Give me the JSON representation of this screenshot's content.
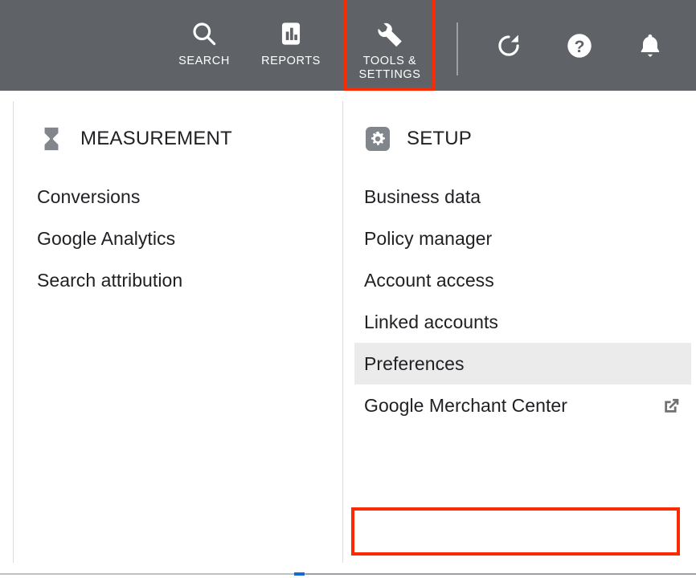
{
  "topbar": {
    "background": "#5f6368",
    "nav": [
      {
        "id": "search",
        "label": "SEARCH",
        "icon": "search-icon"
      },
      {
        "id": "reports",
        "label": "REPORTS",
        "icon": "bar-chart-icon"
      },
      {
        "id": "tools",
        "label": "TOOLS &\nSETTINGS",
        "icon": "wrench-icon"
      }
    ],
    "actions": [
      {
        "id": "refresh",
        "icon": "refresh-icon"
      },
      {
        "id": "help",
        "icon": "help-circle-icon"
      },
      {
        "id": "notify",
        "icon": "bell-icon"
      }
    ]
  },
  "annotations": {
    "highlight_color": "#fc2a00",
    "boxes": [
      "tools-and-settings-nav",
      "preferences-menu-item"
    ]
  },
  "columns": [
    {
      "id": "measurement",
      "heading": "MEASUREMENT",
      "heading_icon": "hourglass-icon",
      "icon_color": "#80868b",
      "items": [
        {
          "label": "Conversions",
          "hovered": false,
          "external": false
        },
        {
          "label": "Google Analytics",
          "hovered": false,
          "external": false
        },
        {
          "label": "Search attribution",
          "hovered": false,
          "external": false
        }
      ]
    },
    {
      "id": "setup",
      "heading": "SETUP",
      "heading_icon": "gear-square-icon",
      "icon_color": "#80868b",
      "items": [
        {
          "label": "Business data",
          "hovered": false,
          "external": false
        },
        {
          "label": "Policy manager",
          "hovered": false,
          "external": false
        },
        {
          "label": "Account access",
          "hovered": false,
          "external": false
        },
        {
          "label": "Linked accounts",
          "hovered": false,
          "external": false
        },
        {
          "label": "Preferences",
          "hovered": true,
          "external": false
        },
        {
          "label": "Google Merchant Center",
          "hovered": false,
          "external": true
        }
      ]
    }
  ],
  "hover_background": "#ebebeb",
  "text_color": "#202124"
}
